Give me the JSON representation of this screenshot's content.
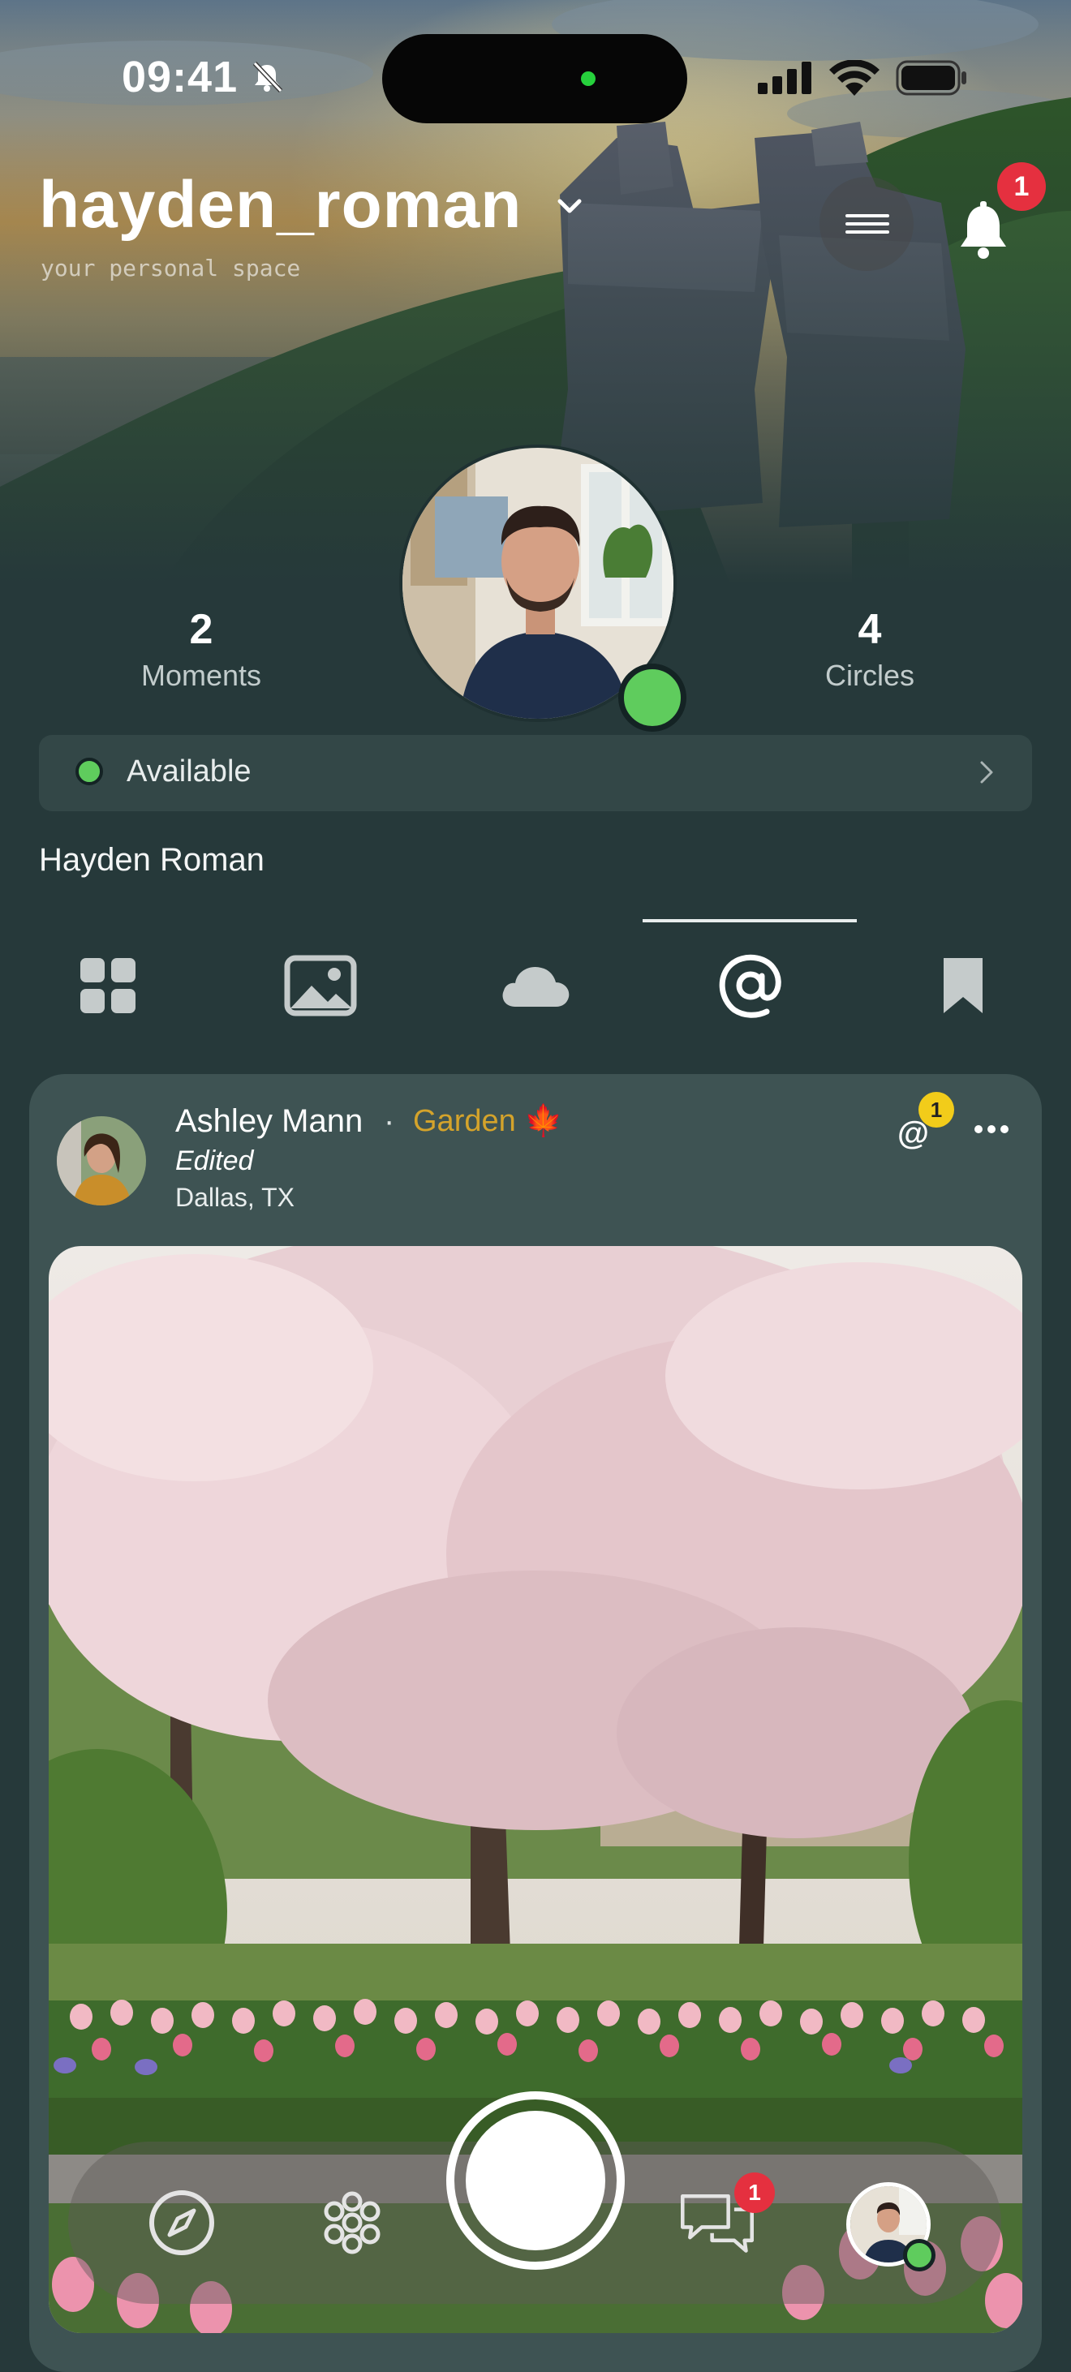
{
  "status_bar": {
    "time": "09:41",
    "icons": [
      "bell-slash-icon",
      "signal-icon",
      "wifi-icon",
      "battery-icon"
    ]
  },
  "header": {
    "username": "hayden_roman",
    "tagline": "your personal space",
    "notifications_count": "1"
  },
  "profile": {
    "moments_count": "2",
    "moments_label": "Moments",
    "circles_count": "4",
    "circles_label": "Circles",
    "status_label": "Available",
    "full_name": "Hayden Roman"
  },
  "tabs": [
    {
      "icon": "grid-icon"
    },
    {
      "icon": "image-icon"
    },
    {
      "icon": "cloud-icon"
    },
    {
      "icon": "at-icon",
      "active": true
    },
    {
      "icon": "bookmark-icon"
    }
  ],
  "post": {
    "author": "Ashley Mann",
    "separator": "·",
    "tag": "Garden 🍁",
    "edited_label": "Edited",
    "location": "Dallas, TX",
    "mention_symbol": "@",
    "mention_count": "1"
  },
  "bottom_nav": {
    "chat_badge": "1"
  },
  "colors": {
    "background": "#26393a",
    "card": "#3e5353",
    "online": "#5fcc5d",
    "badge_red": "#e5303f",
    "badge_yellow": "#f2cc1a",
    "tag_orange": "#d4a32b"
  }
}
